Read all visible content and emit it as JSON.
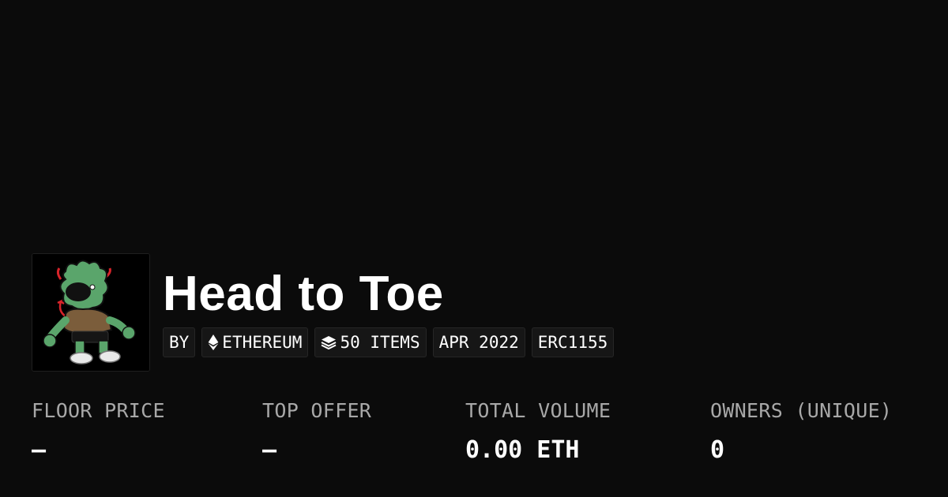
{
  "collection": {
    "title": "Head to Toe",
    "avatar_icon": "cartoon-character-avatar"
  },
  "badges": {
    "by": "BY",
    "chain": "ETHEREUM",
    "chain_icon": "ethereum-icon",
    "items": "50 ITEMS",
    "items_icon": "layers-icon",
    "date": "APR 2022",
    "standard": "ERC1155"
  },
  "stats": [
    {
      "label": "FLOOR PRICE",
      "value": "—"
    },
    {
      "label": "TOP OFFER",
      "value": "—"
    },
    {
      "label": "TOTAL VOLUME",
      "value": "0.00 ETH"
    },
    {
      "label": "OWNERS (UNIQUE)",
      "value": "0"
    }
  ],
  "colors": {
    "background": "#0b0b0b",
    "text": "#ffffff",
    "muted": "#a8a8a8",
    "badge_bg": "#161616"
  }
}
